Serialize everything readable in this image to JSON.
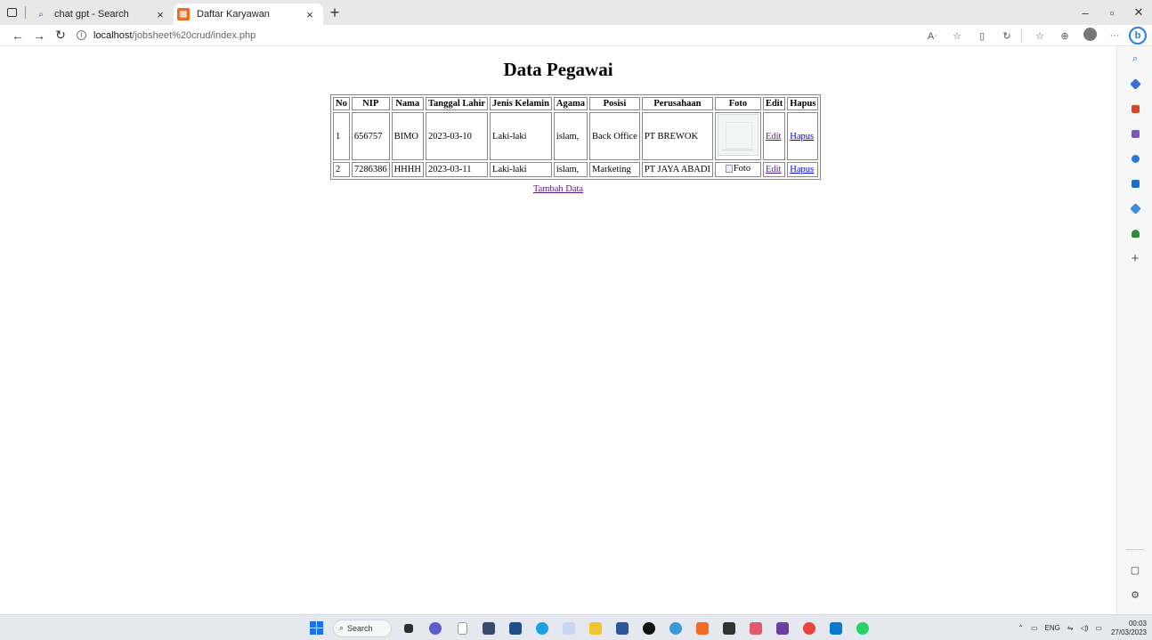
{
  "browser": {
    "tabs": [
      {
        "title": "chat gpt - Search",
        "icon": "search-icon",
        "active": false
      },
      {
        "title": "Daftar Karyawan",
        "icon": "xampp-icon",
        "active": true
      }
    ],
    "new_tab_label": "+",
    "address": {
      "host": "localhost",
      "path": "/jobsheet%20crud/index.php"
    },
    "window_controls": {
      "minimize": "–",
      "restore": "▫",
      "close": "✕"
    }
  },
  "page": {
    "title": "Data Pegawai",
    "table": {
      "headers": [
        "No",
        "NIP",
        "Nama",
        "Tanggal Lahir",
        "Jenis Kelamin",
        "Agama",
        "Posisi",
        "Perusahaan",
        "Foto",
        "Edit",
        "Hapus"
      ],
      "rows": [
        {
          "no": "1",
          "nip": "656757",
          "nama": "BIMO",
          "tanggal_lahir": "2023-03-10",
          "jenis_kelamin": "Laki-laki",
          "agama": "islam,",
          "posisi": "Back Office",
          "perusahaan": "PT BREWOK",
          "foto_alt": "",
          "edit": "Edit",
          "hapus": "Hapus"
        },
        {
          "no": "2",
          "nip": "7286386",
          "nama": "HHHH",
          "tanggal_lahir": "2023-03-11",
          "jenis_kelamin": "Laki-laki",
          "agama": "islam,",
          "posisi": "Marketing",
          "perusahaan": "PT JAYA ABADI",
          "foto_alt": "Foto",
          "edit": "Edit",
          "hapus": "Hapus"
        }
      ]
    },
    "add_link": "Tambah Data"
  },
  "taskbar": {
    "search_label": "Search",
    "lang": "ENG",
    "time": "00:03",
    "date": "27/03/2023"
  },
  "colors": {
    "link": "#0000ee",
    "visited_link": "#551a8b",
    "bing_accent": "#2a7dde",
    "xampp": "#f26b21"
  }
}
